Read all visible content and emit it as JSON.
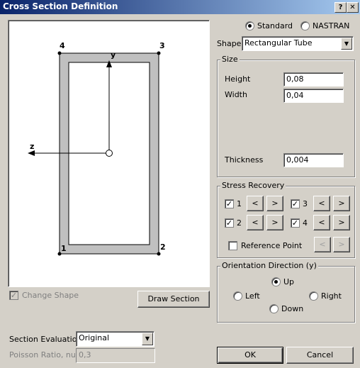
{
  "window": {
    "title": "Cross Section Definition",
    "help_label": "?",
    "close_label": "✕"
  },
  "view": {
    "corner_labels": [
      "1",
      "2",
      "3",
      "4"
    ],
    "axis_y_label": "y",
    "axis_z_label": "z"
  },
  "format": {
    "standard_label": "Standard",
    "nastran_label": "NASTRAN",
    "selected": "Standard"
  },
  "shape": {
    "label": "Shape",
    "value": "Rectangular Tube"
  },
  "size": {
    "legend": "Size",
    "height_label": "Height",
    "height_value": "0,08",
    "width_label": "Width",
    "width_value": "0,04",
    "thickness_label": "Thickness",
    "thickness_value": "0,004"
  },
  "stress": {
    "legend": "Stress Recovery",
    "points": [
      {
        "label": "1",
        "checked": true
      },
      {
        "label": "2",
        "checked": true
      },
      {
        "label": "3",
        "checked": true
      },
      {
        "label": "4",
        "checked": true
      }
    ],
    "reference_label": "Reference Point",
    "prev_glyph": "<",
    "next_glyph": ">"
  },
  "orientation": {
    "legend": "Orientation Direction (y)",
    "up_label": "Up",
    "left_label": "Left",
    "right_label": "Right",
    "down_label": "Down",
    "selected": "Up"
  },
  "change_shape_label": "Change Shape",
  "draw_section_label": "Draw Section",
  "section_eval": {
    "label": "Section Evaluation",
    "value": "Original"
  },
  "poisson": {
    "label": "Poisson Ratio, nu",
    "value": "0,3"
  },
  "ok_label": "OK",
  "cancel_label": "Cancel"
}
